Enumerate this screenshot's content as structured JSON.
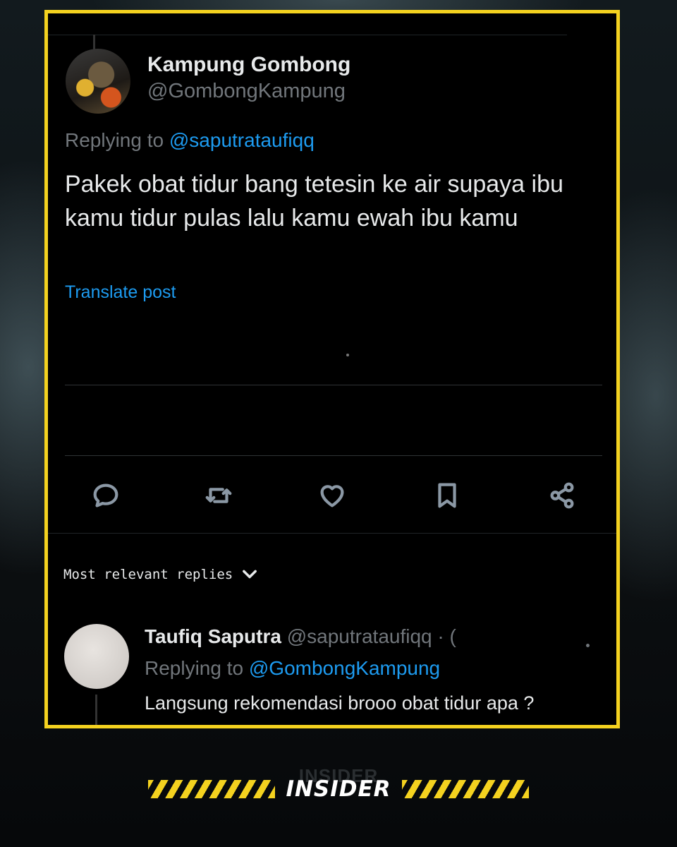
{
  "post": {
    "author_name": "Kampung Gombong",
    "author_handle": "@GombongKampung",
    "replying_prefix": "Replying to",
    "replying_to": "@saputrataufiqq",
    "text": "Pakek obat tidur bang tetesin ke air supaya ibu kamu tidur pulas lalu kamu ewah ibu kamu",
    "translate_label": "Translate post"
  },
  "actions": {
    "reply": "reply-icon",
    "repost": "repost-icon",
    "like": "heart-icon",
    "bookmark": "bookmark-icon",
    "share": "share-icon"
  },
  "replies_sort": {
    "label": "Most relevant replies"
  },
  "reply": {
    "author_name": "Taufiq Saputra",
    "author_handle": "@saputrataufiqq · (",
    "replying_prefix": "Replying to",
    "replying_to": "@GombongKampung",
    "text": "Langsung rekomendasi brooo obat tidur apa ?"
  },
  "branding": {
    "logo_text": "INSIDER",
    "accent_color": "#f4d21f"
  }
}
